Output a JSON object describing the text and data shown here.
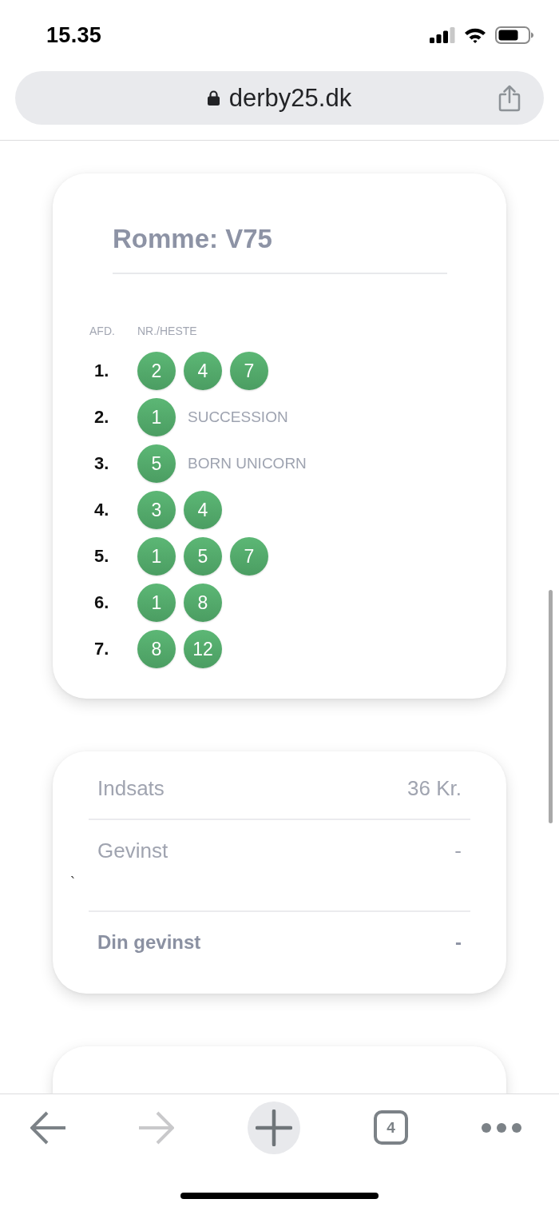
{
  "status_bar": {
    "time": "15.35"
  },
  "browser": {
    "url": "derby25.dk"
  },
  "coupon": {
    "title": "Romme: V75",
    "columns": [
      "AFD.",
      "NR./HESTE"
    ],
    "legs": [
      {
        "label": "1.",
        "numbers": [
          "2",
          "4",
          "7"
        ]
      },
      {
        "label": "2.",
        "numbers": [
          "1"
        ],
        "horse": "SUCCESSION"
      },
      {
        "label": "3.",
        "numbers": [
          "5"
        ],
        "horse": "BORN UNICORN"
      },
      {
        "label": "4.",
        "numbers": [
          "3",
          "4"
        ]
      },
      {
        "label": "5.",
        "numbers": [
          "1",
          "5",
          "7"
        ]
      },
      {
        "label": "6.",
        "numbers": [
          "1",
          "8"
        ]
      },
      {
        "label": "7.",
        "numbers": [
          "8",
          "12"
        ]
      }
    ]
  },
  "summary": {
    "rows": [
      {
        "label": "Indsats",
        "value": "36 Kr.",
        "emphasis": false
      },
      {
        "label": "Gevinst",
        "value": "-",
        "emphasis": false,
        "mark": "`"
      },
      {
        "label": "Din gevinst",
        "value": "-",
        "emphasis": true
      }
    ]
  },
  "toolbar": {
    "buttons": [
      {
        "kind": "back",
        "disabled": false
      },
      {
        "kind": "forward",
        "disabled": true
      },
      {
        "kind": "new_tab",
        "disabled": false
      },
      {
        "kind": "tabs",
        "label": "4",
        "disabled": false
      },
      {
        "kind": "more",
        "disabled": false
      }
    ]
  }
}
